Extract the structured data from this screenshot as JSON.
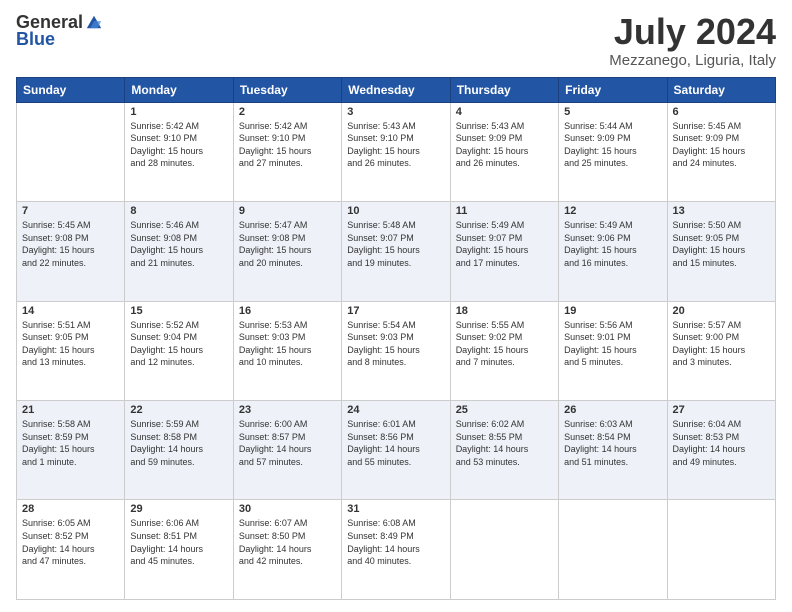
{
  "logo": {
    "general": "General",
    "blue": "Blue"
  },
  "header": {
    "month": "July 2024",
    "location": "Mezzanego, Liguria, Italy"
  },
  "weekdays": [
    "Sunday",
    "Monday",
    "Tuesday",
    "Wednesday",
    "Thursday",
    "Friday",
    "Saturday"
  ],
  "weeks": [
    [
      {
        "day": "",
        "info": ""
      },
      {
        "day": "1",
        "info": "Sunrise: 5:42 AM\nSunset: 9:10 PM\nDaylight: 15 hours\nand 28 minutes."
      },
      {
        "day": "2",
        "info": "Sunrise: 5:42 AM\nSunset: 9:10 PM\nDaylight: 15 hours\nand 27 minutes."
      },
      {
        "day": "3",
        "info": "Sunrise: 5:43 AM\nSunset: 9:10 PM\nDaylight: 15 hours\nand 26 minutes."
      },
      {
        "day": "4",
        "info": "Sunrise: 5:43 AM\nSunset: 9:09 PM\nDaylight: 15 hours\nand 26 minutes."
      },
      {
        "day": "5",
        "info": "Sunrise: 5:44 AM\nSunset: 9:09 PM\nDaylight: 15 hours\nand 25 minutes."
      },
      {
        "day": "6",
        "info": "Sunrise: 5:45 AM\nSunset: 9:09 PM\nDaylight: 15 hours\nand 24 minutes."
      }
    ],
    [
      {
        "day": "7",
        "info": "Sunrise: 5:45 AM\nSunset: 9:08 PM\nDaylight: 15 hours\nand 22 minutes."
      },
      {
        "day": "8",
        "info": "Sunrise: 5:46 AM\nSunset: 9:08 PM\nDaylight: 15 hours\nand 21 minutes."
      },
      {
        "day": "9",
        "info": "Sunrise: 5:47 AM\nSunset: 9:08 PM\nDaylight: 15 hours\nand 20 minutes."
      },
      {
        "day": "10",
        "info": "Sunrise: 5:48 AM\nSunset: 9:07 PM\nDaylight: 15 hours\nand 19 minutes."
      },
      {
        "day": "11",
        "info": "Sunrise: 5:49 AM\nSunset: 9:07 PM\nDaylight: 15 hours\nand 17 minutes."
      },
      {
        "day": "12",
        "info": "Sunrise: 5:49 AM\nSunset: 9:06 PM\nDaylight: 15 hours\nand 16 minutes."
      },
      {
        "day": "13",
        "info": "Sunrise: 5:50 AM\nSunset: 9:05 PM\nDaylight: 15 hours\nand 15 minutes."
      }
    ],
    [
      {
        "day": "14",
        "info": "Sunrise: 5:51 AM\nSunset: 9:05 PM\nDaylight: 15 hours\nand 13 minutes."
      },
      {
        "day": "15",
        "info": "Sunrise: 5:52 AM\nSunset: 9:04 PM\nDaylight: 15 hours\nand 12 minutes."
      },
      {
        "day": "16",
        "info": "Sunrise: 5:53 AM\nSunset: 9:03 PM\nDaylight: 15 hours\nand 10 minutes."
      },
      {
        "day": "17",
        "info": "Sunrise: 5:54 AM\nSunset: 9:03 PM\nDaylight: 15 hours\nand 8 minutes."
      },
      {
        "day": "18",
        "info": "Sunrise: 5:55 AM\nSunset: 9:02 PM\nDaylight: 15 hours\nand 7 minutes."
      },
      {
        "day": "19",
        "info": "Sunrise: 5:56 AM\nSunset: 9:01 PM\nDaylight: 15 hours\nand 5 minutes."
      },
      {
        "day": "20",
        "info": "Sunrise: 5:57 AM\nSunset: 9:00 PM\nDaylight: 15 hours\nand 3 minutes."
      }
    ],
    [
      {
        "day": "21",
        "info": "Sunrise: 5:58 AM\nSunset: 8:59 PM\nDaylight: 15 hours\nand 1 minute."
      },
      {
        "day": "22",
        "info": "Sunrise: 5:59 AM\nSunset: 8:58 PM\nDaylight: 14 hours\nand 59 minutes."
      },
      {
        "day": "23",
        "info": "Sunrise: 6:00 AM\nSunset: 8:57 PM\nDaylight: 14 hours\nand 57 minutes."
      },
      {
        "day": "24",
        "info": "Sunrise: 6:01 AM\nSunset: 8:56 PM\nDaylight: 14 hours\nand 55 minutes."
      },
      {
        "day": "25",
        "info": "Sunrise: 6:02 AM\nSunset: 8:55 PM\nDaylight: 14 hours\nand 53 minutes."
      },
      {
        "day": "26",
        "info": "Sunrise: 6:03 AM\nSunset: 8:54 PM\nDaylight: 14 hours\nand 51 minutes."
      },
      {
        "day": "27",
        "info": "Sunrise: 6:04 AM\nSunset: 8:53 PM\nDaylight: 14 hours\nand 49 minutes."
      }
    ],
    [
      {
        "day": "28",
        "info": "Sunrise: 6:05 AM\nSunset: 8:52 PM\nDaylight: 14 hours\nand 47 minutes."
      },
      {
        "day": "29",
        "info": "Sunrise: 6:06 AM\nSunset: 8:51 PM\nDaylight: 14 hours\nand 45 minutes."
      },
      {
        "day": "30",
        "info": "Sunrise: 6:07 AM\nSunset: 8:50 PM\nDaylight: 14 hours\nand 42 minutes."
      },
      {
        "day": "31",
        "info": "Sunrise: 6:08 AM\nSunset: 8:49 PM\nDaylight: 14 hours\nand 40 minutes."
      },
      {
        "day": "",
        "info": ""
      },
      {
        "day": "",
        "info": ""
      },
      {
        "day": "",
        "info": ""
      }
    ]
  ]
}
